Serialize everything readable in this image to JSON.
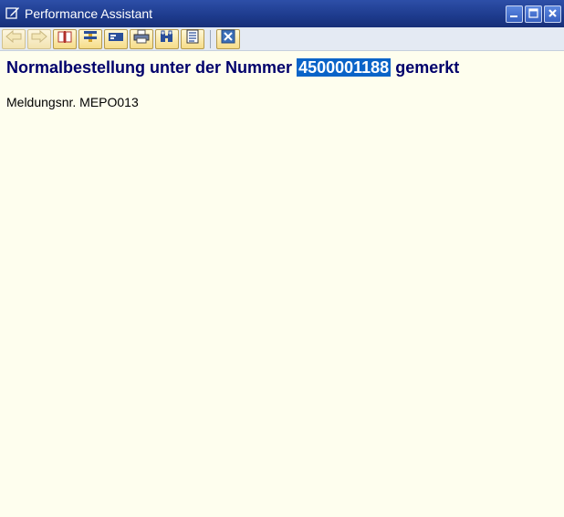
{
  "window": {
    "title": "Performance Assistant",
    "controls": [
      "minimize",
      "maximize",
      "close"
    ]
  },
  "toolbar": {
    "buttons": [
      {
        "icon": "back-arrow-icon",
        "enabled": false
      },
      {
        "icon": "forward-arrow-icon",
        "enabled": false
      },
      {
        "icon": "book-icon",
        "enabled": true
      },
      {
        "icon": "technical-info-icon",
        "enabled": true
      },
      {
        "icon": "display-icon",
        "enabled": true
      },
      {
        "icon": "print-icon",
        "enabled": true
      },
      {
        "icon": "find-icon",
        "enabled": true
      },
      {
        "icon": "notes-icon",
        "enabled": true
      },
      {
        "icon": "close-icon",
        "enabled": true
      }
    ]
  },
  "message": {
    "heading_prefix": "Normalbestellung unter der Nummer",
    "heading_number": "4500001188",
    "heading_suffix": "gemerkt",
    "message_number_line": "Meldungsnr. MEPO013"
  },
  "colors": {
    "titlebar": "#1d3a8c",
    "background": "#fefeee",
    "heading": "#00006b",
    "highlight": "#0a64c8"
  }
}
